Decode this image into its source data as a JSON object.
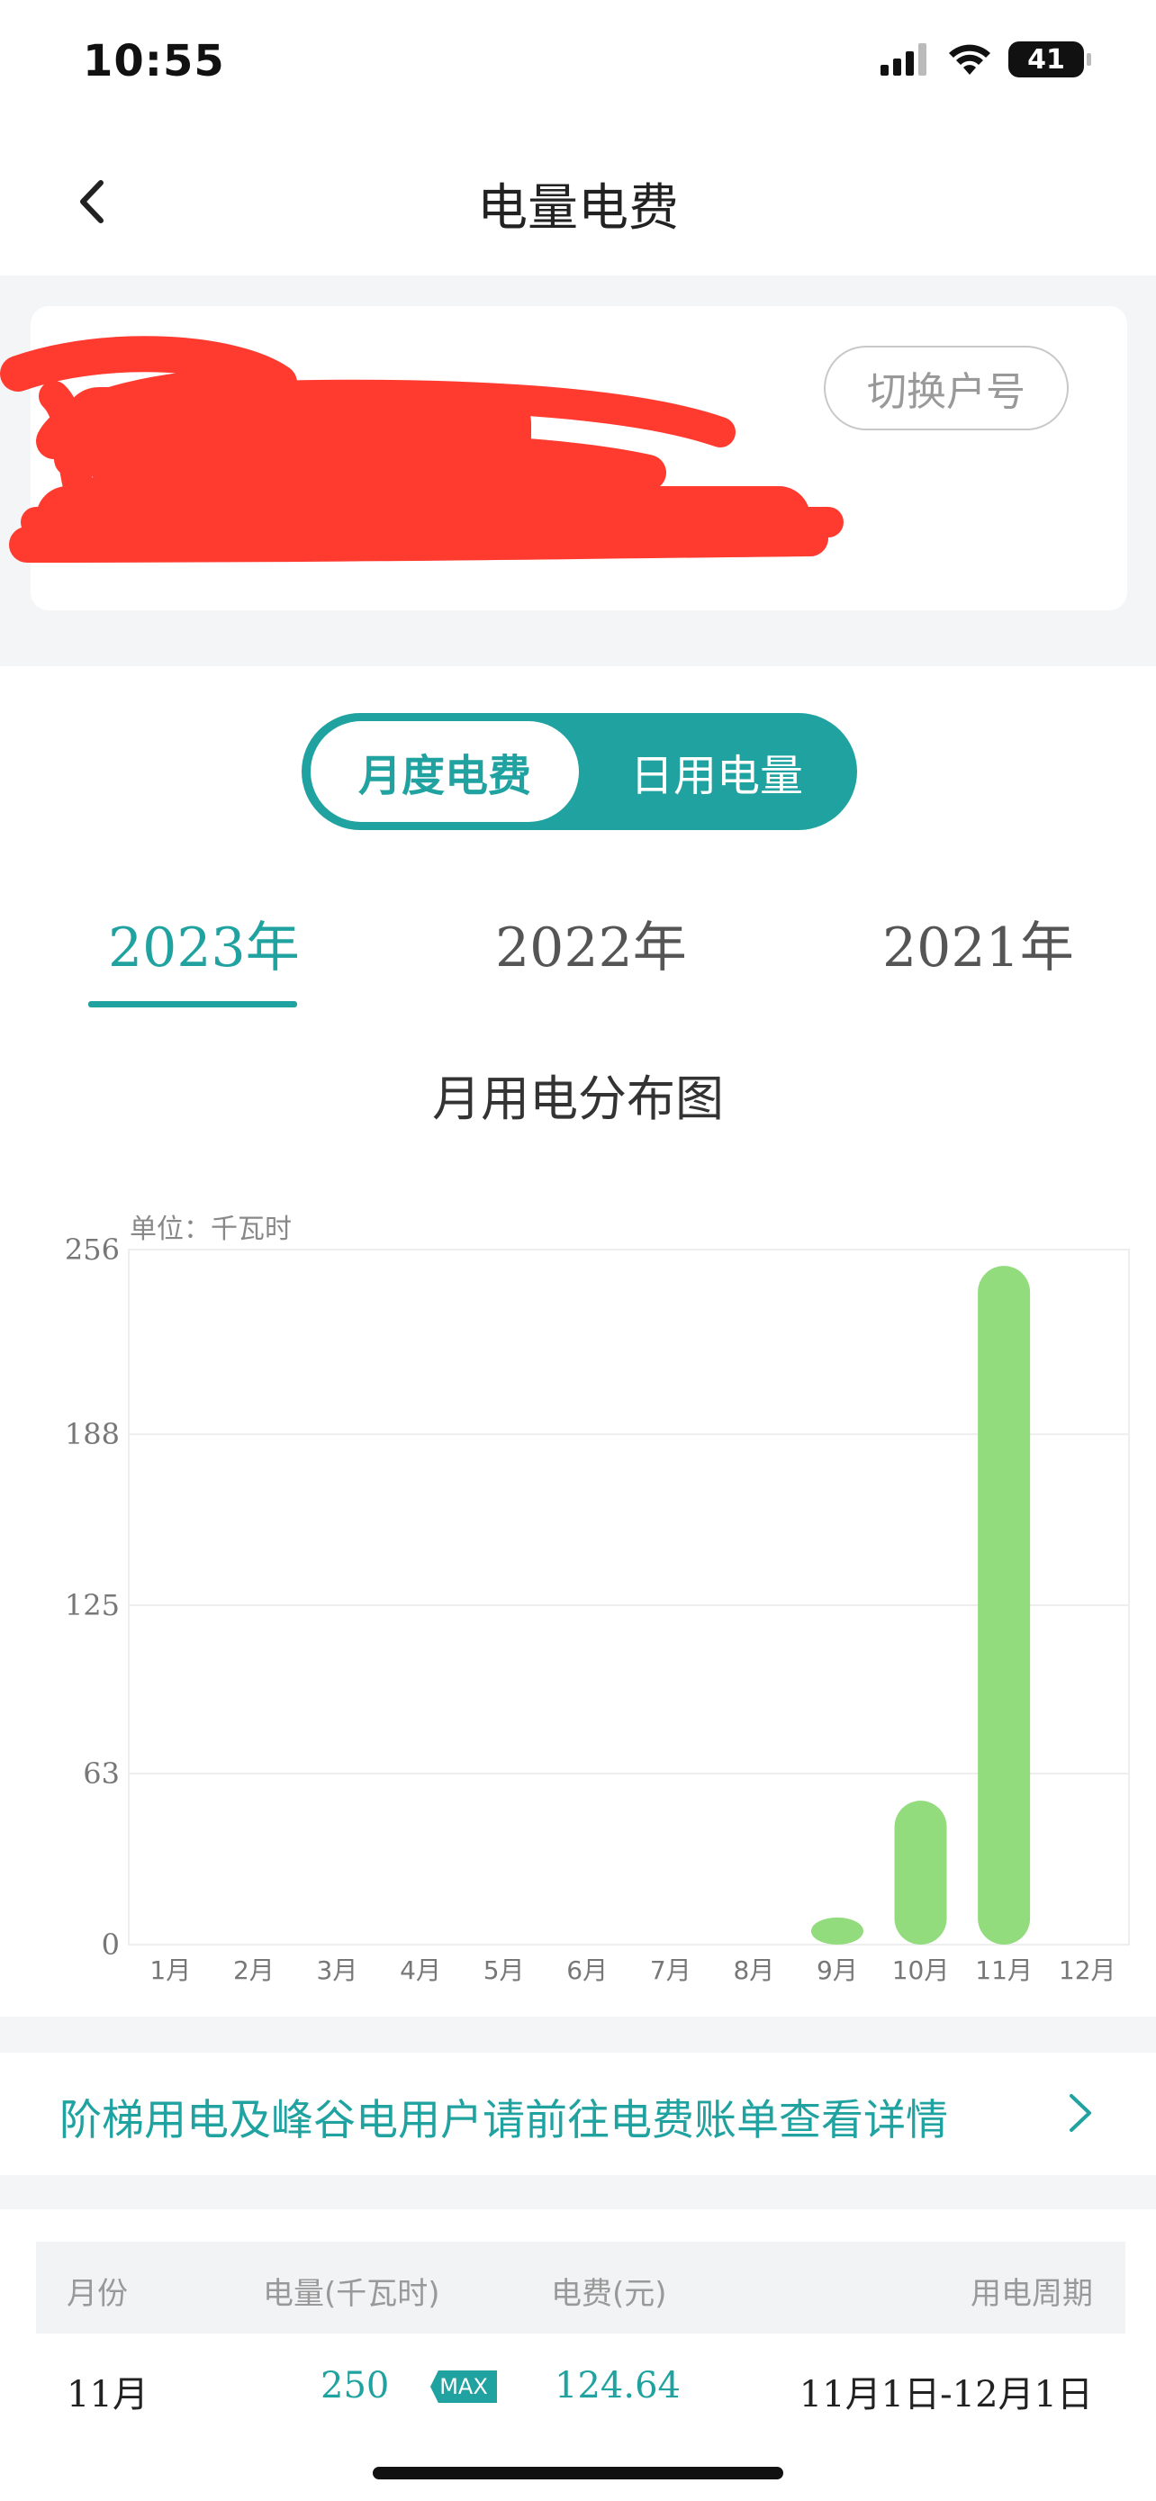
{
  "status_bar": {
    "time": "10:55",
    "battery": "41"
  },
  "nav": {
    "title": "电量电费"
  },
  "account": {
    "switch_label": "切换户号"
  },
  "toggle": {
    "monthly": "月度电费",
    "daily": "日用电量"
  },
  "year_tabs": [
    "2023年",
    "2022年",
    "2021年"
  ],
  "selected_year": "2023年",
  "chart": {
    "title": "月用电分布图",
    "unit": "单位：千瓦时"
  },
  "chart_data": {
    "type": "bar",
    "title": "月用电分布图",
    "ylabel": "单位：千瓦时",
    "categories": [
      "1月",
      "2月",
      "3月",
      "4月",
      "5月",
      "6月",
      "7月",
      "8月",
      "9月",
      "10月",
      "11月",
      "12月"
    ],
    "values": [
      0,
      0,
      0,
      0,
      0,
      0,
      0,
      0,
      10,
      53,
      250,
      0
    ],
    "yticks": [
      "0",
      "63",
      "125",
      "188",
      "256"
    ],
    "ylim": [
      0,
      256
    ],
    "grid": true,
    "bar_color": "#92dc7e"
  },
  "notice": {
    "text": "阶梯用电及峰谷电用户请前往电费账单查看详情"
  },
  "table": {
    "headers": {
      "month": "月份",
      "usage": "电量(千瓦时)",
      "fee": "电费(元)",
      "period": "用电周期"
    },
    "rows": [
      {
        "month": "11月",
        "usage": "250",
        "badge": "MAX",
        "fee": "124.64",
        "period": "11月1日-12月1日"
      }
    ]
  },
  "colors": {
    "accent": "#20a3a0",
    "bar": "#92dc7e",
    "band": "#f4f5f7"
  }
}
